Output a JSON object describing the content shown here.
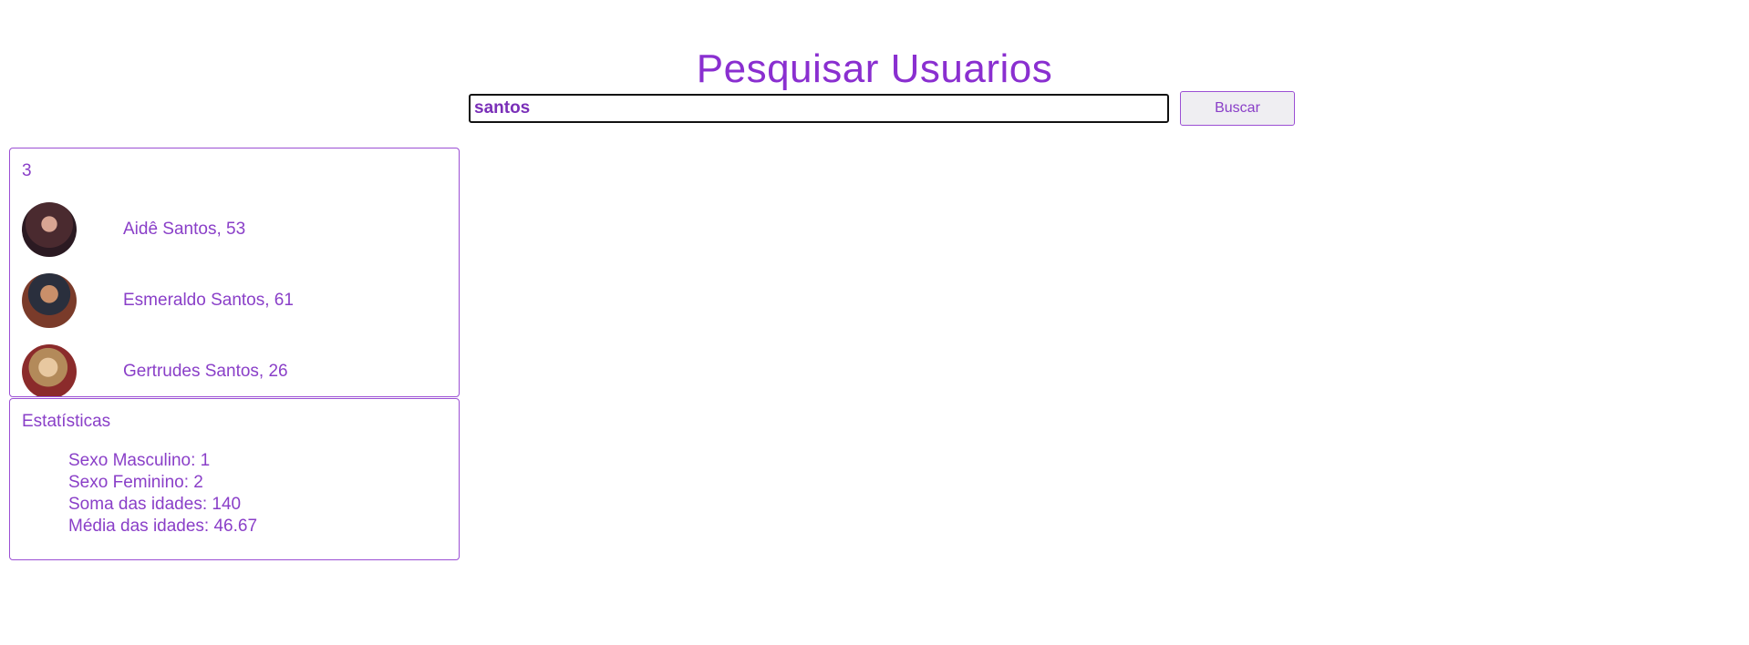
{
  "header": {
    "title": "Pesquisar Usuarios"
  },
  "search": {
    "value": "santos",
    "button_label": "Buscar"
  },
  "results": {
    "count": "3",
    "users": [
      {
        "label": "Aidê Santos, 53",
        "avatar": "female-portrait-avatar"
      },
      {
        "label": "Esmeraldo Santos, 61",
        "avatar": "male-portrait-avatar"
      },
      {
        "label": "Gertrudes Santos, 26",
        "avatar": "female-portrait-avatar"
      }
    ]
  },
  "stats": {
    "title": "Estatísticas",
    "items": [
      "Sexo Masculino: 1",
      "Sexo Feminino: 2",
      "Soma das idades: 140",
      "Média das idades: 46.67"
    ]
  },
  "colors": {
    "accent": "#8a2fd0",
    "text": "#8a3fc8",
    "border": "#9b4fd4",
    "button_bg": "#efeef2"
  }
}
